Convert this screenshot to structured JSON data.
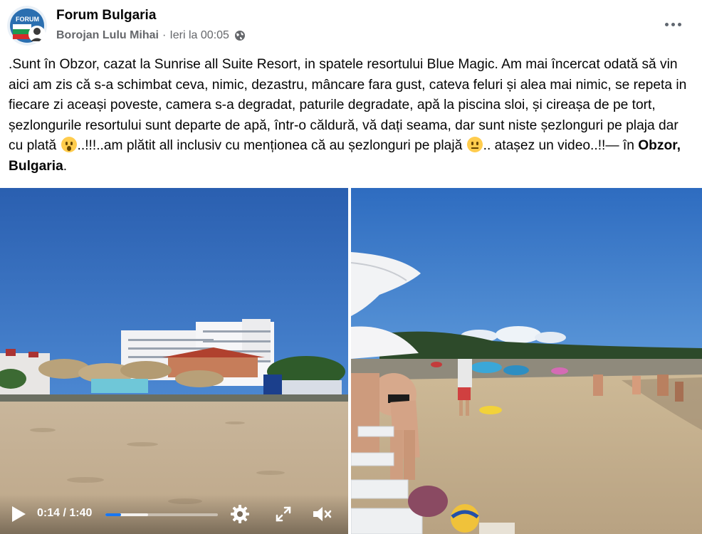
{
  "post": {
    "group_name": "Forum Bulgaria",
    "author": "Borojan Lulu Mihai",
    "separator": "·",
    "timestamp": "Ieri la 00:05",
    "privacy_icon": "globe-icon",
    "more_icon": "more-options-icon",
    "avatar_text": "FORUM",
    "text_part1": ".Sunt în Obzor, cazat la Sunrise all Suite Resort, in spatele resortului Blue Magic. Am mai încercat odată să vin aici am zis că s-a schimbat ceva, nimic, dezastru, mâncare fara gust, cateva feluri și alea mai nimic, se repeta in fiecare zi aceași poveste, camera s-a degradat, paturile degradate, apă la piscina sloi, și cireașa de pe tort, șezlongurile resortului sunt departe de apă, într-o căldură, vă dați seama, dar sunt niste șezlonguri pe plaja dar cu plată",
    "emoji1": "astonished-face-emoji",
    "text_part2": "..!!!..am plătit all inclusiv cu menționea că au șezlonguri pe plajă",
    "emoji2": "neutral-face-emoji",
    "text_part3": ".. atașez un video..!!— în",
    "location": "Obzor, Bulgaria",
    "text_end": "."
  },
  "video": {
    "current_time": "0:14",
    "duration": "1:40",
    "time_display": "0:14 / 1:40",
    "progress": 0.14,
    "buffered": 0.38,
    "icons": {
      "play": "play-icon",
      "settings": "gear-icon",
      "fullscreen": "fullscreen-icon",
      "mute": "muted-speaker-icon"
    }
  },
  "colors": {
    "secondary_text": "#65676b",
    "accent": "#1877f2",
    "sky": "#2a66b6"
  }
}
